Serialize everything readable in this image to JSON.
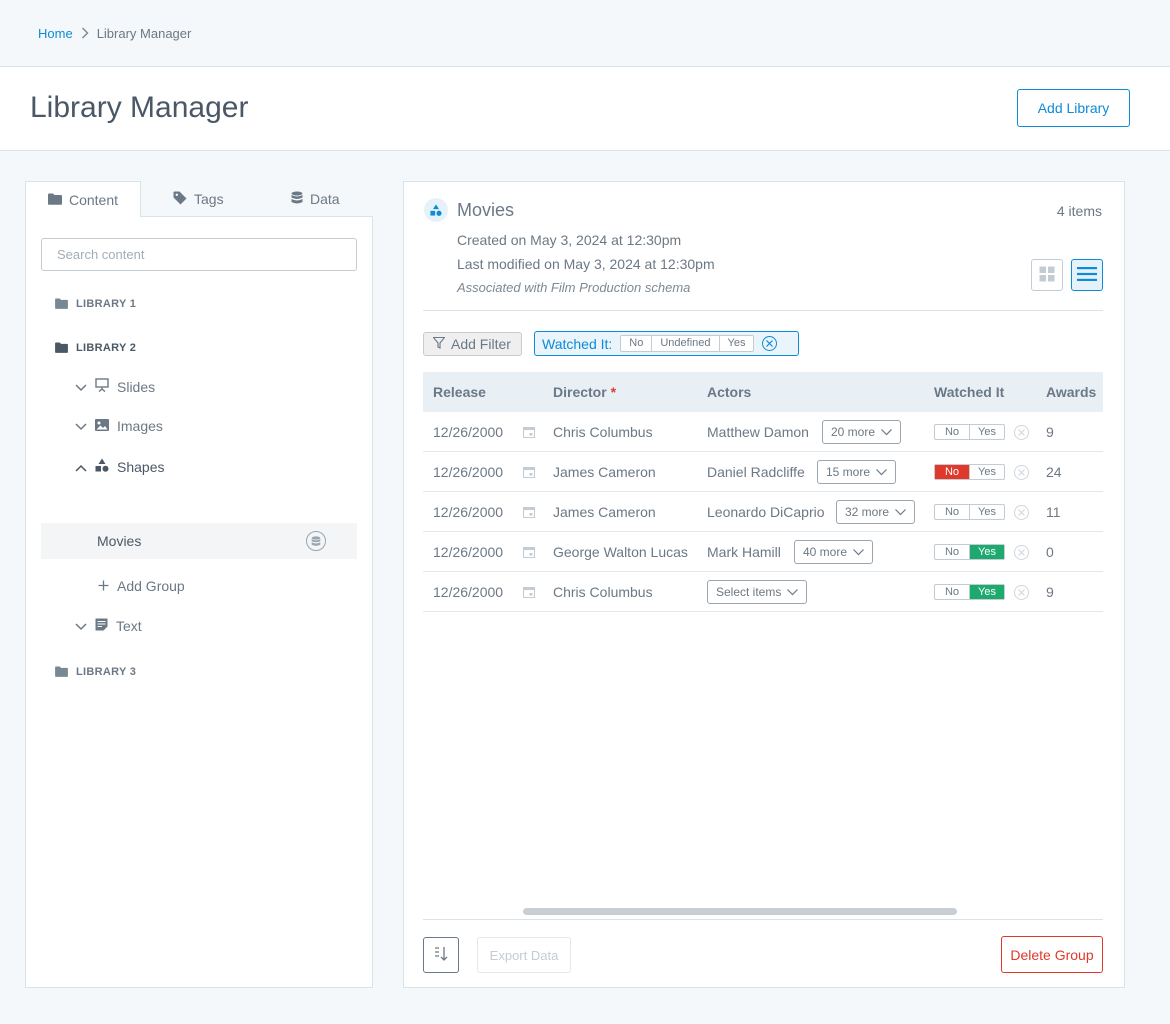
{
  "breadcrumb": {
    "home": "Home",
    "current": "Library Manager"
  },
  "page": {
    "title": "Library Manager",
    "add_library": "Add Library"
  },
  "sidebar": {
    "tabs": [
      {
        "label": "Content",
        "icon": "folder-icon"
      },
      {
        "label": "Tags",
        "icon": "tag-icon"
      },
      {
        "label": "Data",
        "icon": "database-icon"
      }
    ],
    "search_placeholder": "Search content",
    "libraries": [
      "LIBRARY 1",
      "LIBRARY 2",
      "LIBRARY 3"
    ],
    "nodes": {
      "slides": "Slides",
      "images": "Images",
      "shapes": "Shapes",
      "movies": "Movies",
      "add_group": "Add Group",
      "text": "Text"
    }
  },
  "group": {
    "name": "Movies",
    "count": "4 items",
    "created": "Created on May 3, 2024 at 12:30pm",
    "modified": "Last modified on May 3, 2024 at 12:30pm",
    "schema": "Associated with Film Production schema"
  },
  "filters": {
    "add_filter": "Add Filter",
    "chip_label": "Watched It:",
    "chip_options": [
      "No",
      "Undefined",
      "Yes"
    ]
  },
  "table": {
    "columns": [
      "Release",
      "Director",
      "Actors",
      "Watched It",
      "Awards"
    ],
    "required_marker": "*",
    "rows": [
      {
        "release": "12/26/2000",
        "director": "Chris Columbus",
        "actor": "Matthew Damon",
        "more": "20 more",
        "watched": "none",
        "no": "No",
        "yes": "Yes",
        "awards": "9"
      },
      {
        "release": "12/26/2000",
        "director": "James Cameron",
        "actor": "Daniel Radcliffe",
        "more": "15 more",
        "watched": "no",
        "no": "No",
        "yes": "Yes",
        "awards": "24"
      },
      {
        "release": "12/26/2000",
        "director": "James Cameron",
        "actor": "Leonardo DiCaprio",
        "more": "32 more",
        "watched": "none",
        "no": "No",
        "yes": "Yes",
        "awards": "11"
      },
      {
        "release": "12/26/2000",
        "director": "George Walton Lucas",
        "actor": "Mark Hamill",
        "more": "40 more",
        "watched": "yes",
        "no": "No",
        "yes": "Yes",
        "awards": "0"
      },
      {
        "release": "12/26/2000",
        "director": "Chris Columbus",
        "actor": "",
        "more": "Select items",
        "watched": "yes",
        "no": "No",
        "yes": "Yes",
        "awards": "9"
      }
    ]
  },
  "footer": {
    "export": "Export Data",
    "delete": "Delete Group"
  },
  "colors": {
    "accent": "#0d8bd6",
    "danger": "#e0392b",
    "success": "#1eaa6e"
  }
}
